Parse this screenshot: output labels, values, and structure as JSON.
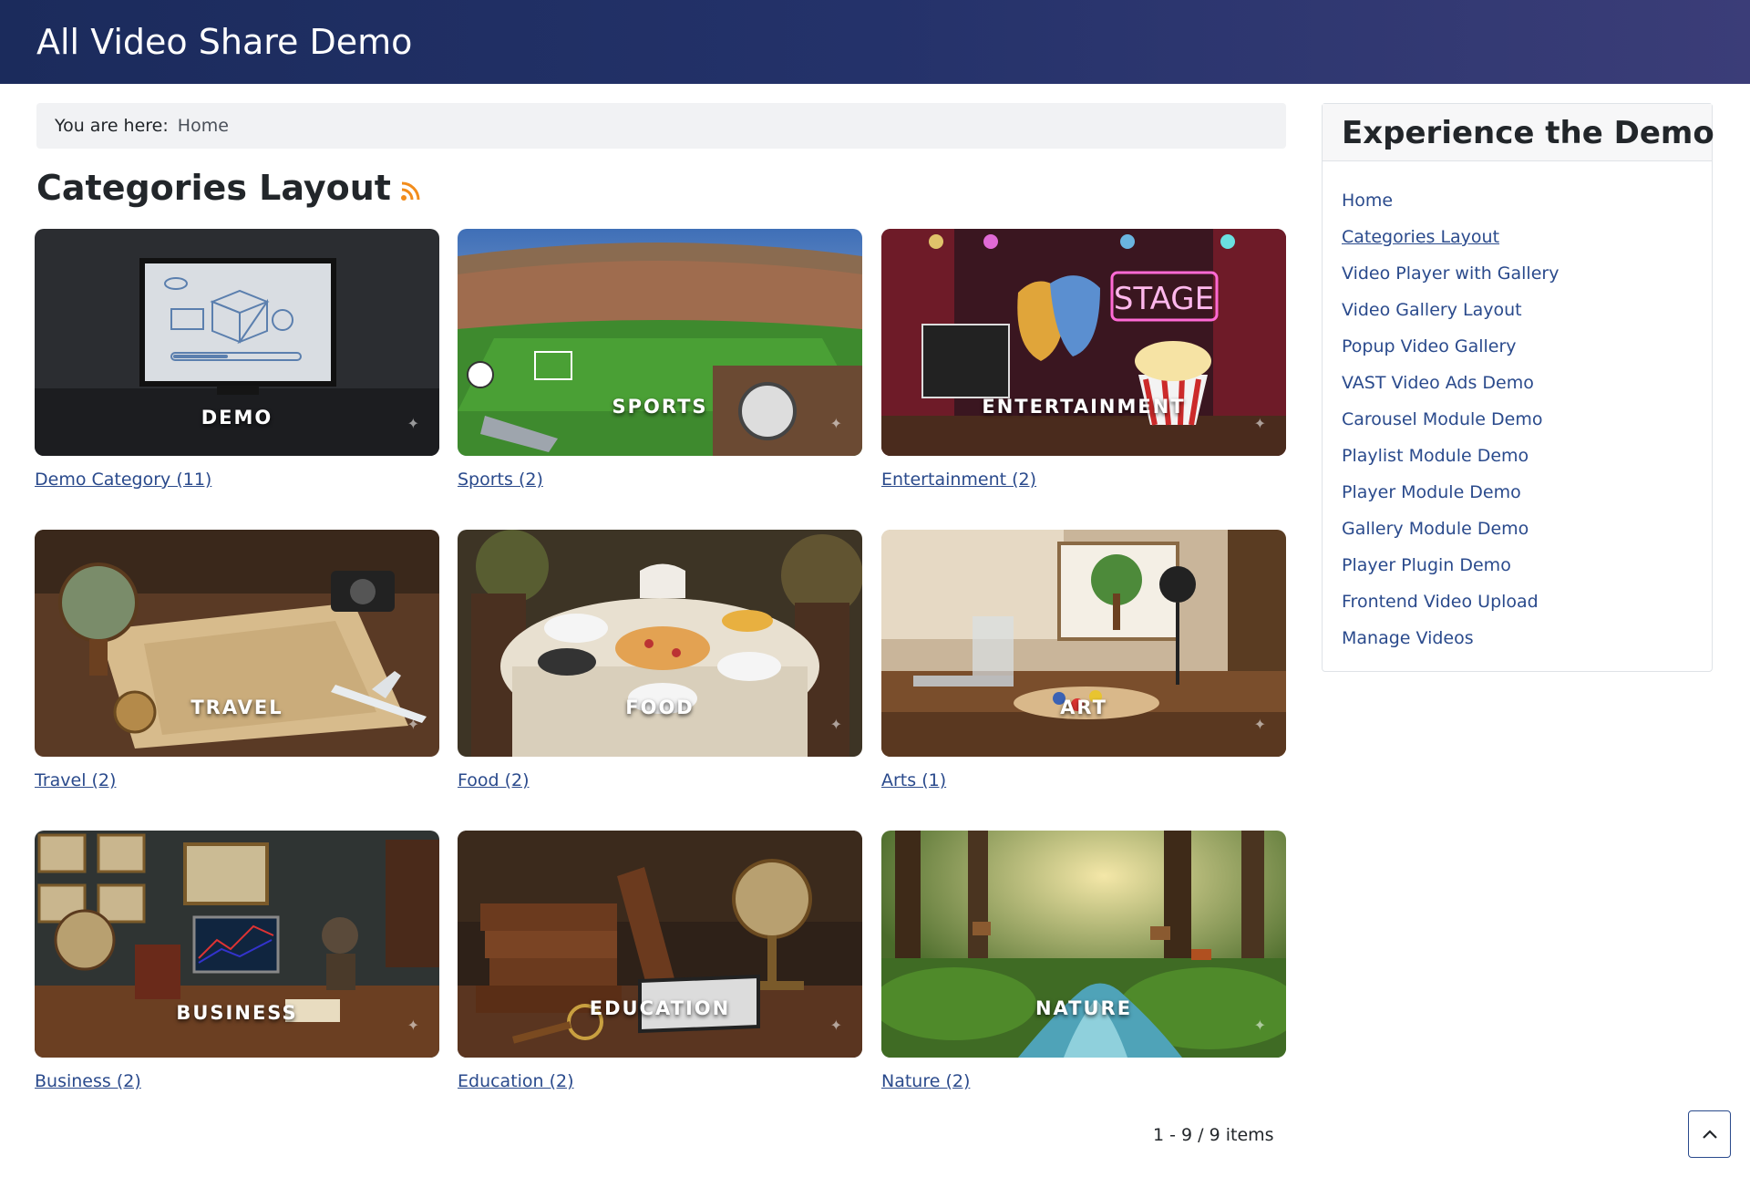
{
  "header": {
    "title": "All Video Share Demo"
  },
  "breadcrumb": {
    "label": "You are here:",
    "current": "Home"
  },
  "page": {
    "title": "Categories Layout",
    "rss_icon": "rss-icon"
  },
  "categories": [
    {
      "word": "DEMO",
      "link": "Demo Category (11)"
    },
    {
      "word": "SPORTS",
      "link": "Sports (2)"
    },
    {
      "word": "ENTERTAINMENT",
      "link": "Entertainment (2)"
    },
    {
      "word": "TRAVEL",
      "link": "Travel (2)"
    },
    {
      "word": "FOOD",
      "link": "Food (2)"
    },
    {
      "word": "ART",
      "link": "Arts (1)"
    },
    {
      "word": "BUSINESS",
      "link": "Business (2)"
    },
    {
      "word": "EDUCATION",
      "link": "Education (2)"
    },
    {
      "word": "NATURE",
      "link": "Nature (2)"
    }
  ],
  "thumb_texts": {
    "stage_sign": "STAGE"
  },
  "pagination": {
    "summary": "1 - 9 / 9 items"
  },
  "sidebar": {
    "title": "Experience the Demo",
    "items": [
      {
        "label": "Home"
      },
      {
        "label": "Categories Layout"
      },
      {
        "label": "Video Player with Gallery"
      },
      {
        "label": "Video Gallery Layout"
      },
      {
        "label": "Popup Video Gallery"
      },
      {
        "label": "VAST Video Ads Demo"
      },
      {
        "label": "Carousel Module Demo"
      },
      {
        "label": "Playlist Module Demo"
      },
      {
        "label": "Player Module Demo"
      },
      {
        "label": "Gallery Module Demo"
      },
      {
        "label": "Player Plugin Demo"
      },
      {
        "label": "Frontend Video Upload"
      },
      {
        "label": "Manage Videos"
      }
    ]
  },
  "colors": {
    "header_start": "#1b2b5c",
    "header_end": "#3b3d78",
    "link": "#2a4a8c",
    "rss": "#f28c1b"
  }
}
